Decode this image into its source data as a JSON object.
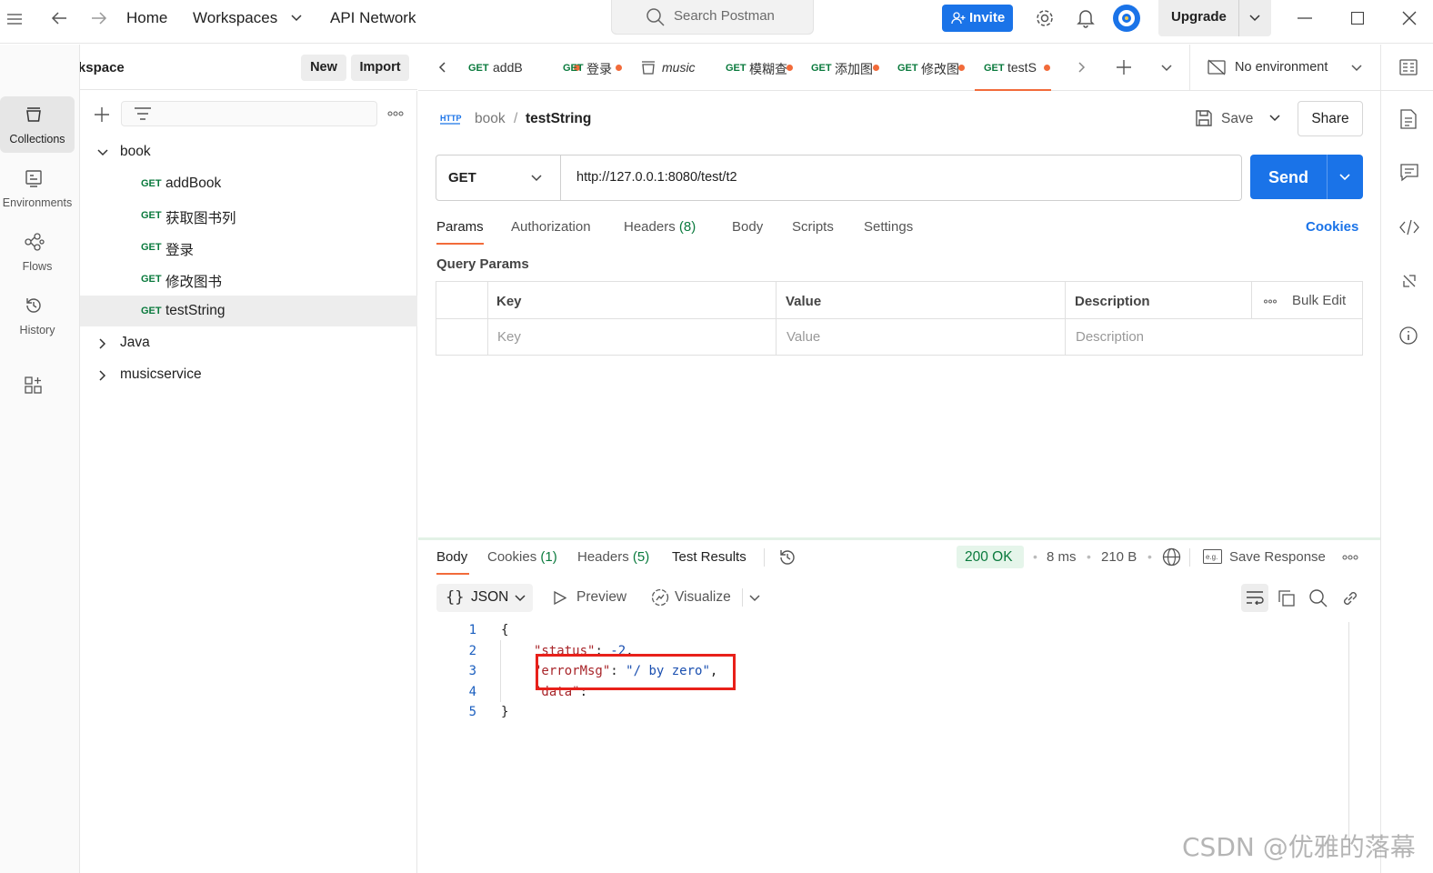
{
  "topbar": {
    "home": "Home",
    "workspaces": "Workspaces",
    "api_network": "API Network",
    "search_placeholder": "Search Postman",
    "invite": "Invite",
    "upgrade": "Upgrade"
  },
  "workspace": {
    "name": "My Workspace",
    "new_label": "New",
    "import_label": "Import"
  },
  "rail": [
    {
      "label": "Collections",
      "icon": "collections-icon"
    },
    {
      "label": "Environments",
      "icon": "environments-icon"
    },
    {
      "label": "Flows",
      "icon": "flows-icon"
    },
    {
      "label": "History",
      "icon": "history-icon"
    }
  ],
  "tree": {
    "book": "book",
    "items": [
      {
        "method": "GET",
        "name": "addBook"
      },
      {
        "method": "GET",
        "name": "获取图书列"
      },
      {
        "method": "GET",
        "name": "登录"
      },
      {
        "method": "GET",
        "name": "修改图书"
      },
      {
        "method": "GET",
        "name": "testString"
      }
    ],
    "java": "Java",
    "musicservice": "musicservice"
  },
  "tabs": [
    {
      "method": "GET",
      "title": "addB"
    },
    {
      "method": "GET",
      "title": "登录"
    },
    {
      "method": "",
      "title": "music"
    },
    {
      "method": "GET",
      "title": "模糊查"
    },
    {
      "method": "GET",
      "title": "添加图"
    },
    {
      "method": "GET",
      "title": "修改图"
    },
    {
      "method": "GET",
      "title": "testS"
    }
  ],
  "environment": "No environment",
  "request": {
    "collection": "book",
    "separator": "/",
    "name": "testString",
    "save": "Save",
    "share": "Share",
    "method": "GET",
    "url": "http://127.0.0.1:8080/test/t2",
    "send": "Send",
    "tabs": {
      "params": "Params",
      "authorization": "Authorization",
      "headers": "Headers",
      "headers_count": "(8)",
      "body": "Body",
      "scripts": "Scripts",
      "settings": "Settings"
    },
    "cookies": "Cookies",
    "query_params_title": "Query Params",
    "table": {
      "key": "Key",
      "value": "Value",
      "description": "Description",
      "bulk_edit": "Bulk Edit",
      "key_ph": "Key",
      "value_ph": "Value",
      "description_ph": "Description"
    }
  },
  "response": {
    "tabs": {
      "body": "Body",
      "cookies": "Cookies",
      "cookies_count": "(1)",
      "headers": "Headers",
      "headers_count": "(5)",
      "test_results": "Test Results"
    },
    "status": "200 OK",
    "time": "8 ms",
    "size": "210 B",
    "save_response": "Save Response",
    "format": "JSON",
    "preview": "Preview",
    "visualize": "Visualize",
    "lines": [
      {
        "n": "1"
      },
      {
        "n": "2",
        "key": "\"status\"",
        "val": "-2"
      },
      {
        "n": "3",
        "key": "\"errorMsg\"",
        "val": "\"/ by zero\""
      },
      {
        "n": "4",
        "key": "\"data\"",
        "val": ""
      },
      {
        "n": "5"
      }
    ]
  },
  "watermark": "CSDN @优雅的落幕",
  "colors": {
    "accent": "#f26b3a",
    "primary": "#1a73e8",
    "get_method": "#0a7a3d",
    "highlight_box": "#e8201a"
  }
}
